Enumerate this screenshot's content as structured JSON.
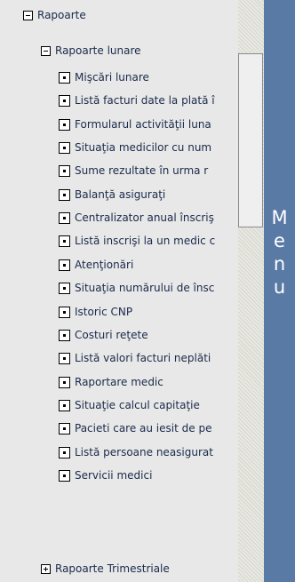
{
  "tree": {
    "root": {
      "label": "Rapoarte",
      "expanded": true
    },
    "group": {
      "label": "Rapoarte lunare",
      "expanded": true
    },
    "items": [
      "Mişcări lunare",
      "Listă facturi date la plată î",
      "Formularul activităţii luna",
      "Situaţia medicilor cu num",
      "Sume rezultate în urma r",
      "Balanţă asiguraţi",
      "Centralizator anual înscriş",
      "Listă inscrişi la un medic c",
      "Atenţionări",
      "Situaţia numărului de însc",
      "Istoric CNP",
      "Costuri reţete",
      "Listă valori facturi neplăti",
      "Raportare medic",
      "Situaţie calcul capitaţie",
      "Pacieti care au iesit de pe",
      "Listă persoane neasigurat",
      "Servicii medici"
    ],
    "collapsed_group": {
      "label": "Rapoarte Trimestriale",
      "expanded": false
    }
  },
  "menu": {
    "label": "Menu"
  }
}
